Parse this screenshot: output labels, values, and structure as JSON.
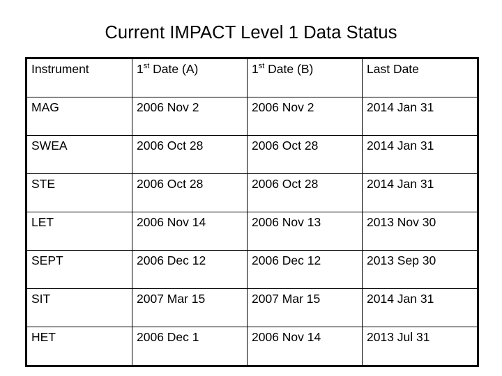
{
  "slide": {
    "title": "Current IMPACT Level 1 Data Status",
    "background_color": "#ffffff",
    "text_color": "#000000",
    "border_color": "#000000"
  },
  "table": {
    "columns": [
      {
        "key": "instrument",
        "label": "Instrument"
      },
      {
        "key": "first_date_a",
        "label_prefix": "1",
        "label_sup": "st",
        "label_suffix": " Date (A)"
      },
      {
        "key": "first_date_b",
        "label_prefix": "1",
        "label_sup": "st",
        "label_suffix": " Date (B)"
      },
      {
        "key": "last_date",
        "label": "Last Date"
      }
    ],
    "rows": [
      {
        "instrument": "MAG",
        "first_date_a": "2006 Nov 2",
        "first_date_b": "2006 Nov 2",
        "last_date": "2014 Jan 31"
      },
      {
        "instrument": "SWEA",
        "first_date_a": "2006 Oct 28",
        "first_date_b": "2006 Oct 28",
        "last_date": "2014 Jan 31"
      },
      {
        "instrument": "STE",
        "first_date_a": "2006 Oct 28",
        "first_date_b": "2006 Oct 28",
        "last_date": "2014 Jan 31"
      },
      {
        "instrument": "LET",
        "first_date_a": "2006 Nov 14",
        "first_date_b": "2006 Nov 13",
        "last_date": "2013 Nov 30"
      },
      {
        "instrument": "SEPT",
        "first_date_a": "2006 Dec 12",
        "first_date_b": "2006 Dec 12",
        "last_date": "2013 Sep 30"
      },
      {
        "instrument": "SIT",
        "first_date_a": "2007 Mar 15",
        "first_date_b": "2007 Mar 15",
        "last_date": "2014 Jan 31"
      },
      {
        "instrument": "HET",
        "first_date_a": "2006 Dec 1",
        "first_date_b": "2006 Nov 14",
        "last_date": "2013 Jul 31"
      }
    ]
  }
}
